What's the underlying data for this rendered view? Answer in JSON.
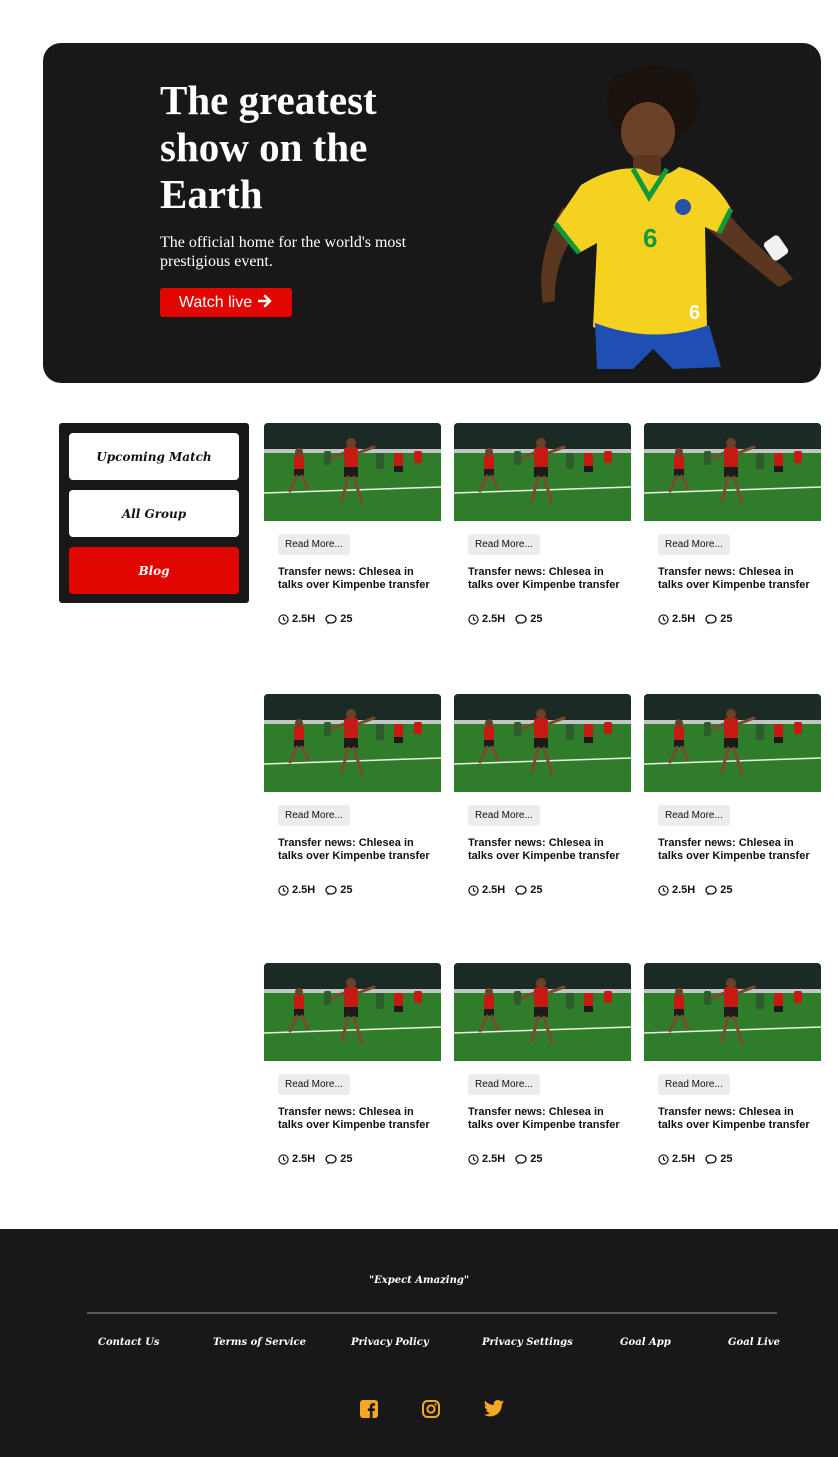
{
  "hero": {
    "title": "The greatest show on the Earth",
    "subtitle": "The official home for the world's most prestigious event.",
    "button_label": "Watch live",
    "button_icon": "arrow-right-icon",
    "accent_color": "#e10600",
    "background_color": "#181818"
  },
  "sidebar": {
    "items": [
      {
        "label": "Upcoming Match",
        "active": false
      },
      {
        "label": "All Group",
        "active": false
      },
      {
        "label": "Blog",
        "active": true
      }
    ]
  },
  "articles": [
    {
      "read_more": "Read More...",
      "headline": "Transfer news: Chlesea in talks over Kimpenbe transfer",
      "time": "2.5H",
      "comments": "25"
    },
    {
      "read_more": "Read More...",
      "headline": "Transfer news: Chlesea in talks over Kimpenbe transfer",
      "time": "2.5H",
      "comments": "25"
    },
    {
      "read_more": "Read More...",
      "headline": "Transfer news: Chlesea in talks over Kimpenbe transfer",
      "time": "2.5H",
      "comments": "25"
    },
    {
      "read_more": "Read More...",
      "headline": "Transfer news: Chlesea in talks over Kimpenbe transfer",
      "time": "2.5H",
      "comments": "25"
    },
    {
      "read_more": "Read More...",
      "headline": "Transfer news: Chlesea in talks over Kimpenbe transfer",
      "time": "2.5H",
      "comments": "25"
    },
    {
      "read_more": "Read More...",
      "headline": "Transfer news: Chlesea in talks over Kimpenbe transfer",
      "time": "2.5H",
      "comments": "25"
    },
    {
      "read_more": "Read More...",
      "headline": "Transfer news: Chlesea in talks over Kimpenbe transfer",
      "time": "2.5H",
      "comments": "25"
    },
    {
      "read_more": "Read More...",
      "headline": "Transfer news: Chlesea in talks over Kimpenbe transfer",
      "time": "2.5H",
      "comments": "25"
    },
    {
      "read_more": "Read More...",
      "headline": "Transfer news: Chlesea in talks over Kimpenbe transfer",
      "time": "2.5H",
      "comments": "25"
    }
  ],
  "footer": {
    "tagline": "\"Expect Amazing\"",
    "links": [
      "Contact Us",
      "Terms of Service",
      "Privacy Policy",
      "Privacy Settings",
      "Goal App",
      "Goal Live"
    ],
    "social_icons": [
      "facebook-icon",
      "instagram-icon",
      "twitter-icon"
    ],
    "social_color": "#f5a623"
  }
}
